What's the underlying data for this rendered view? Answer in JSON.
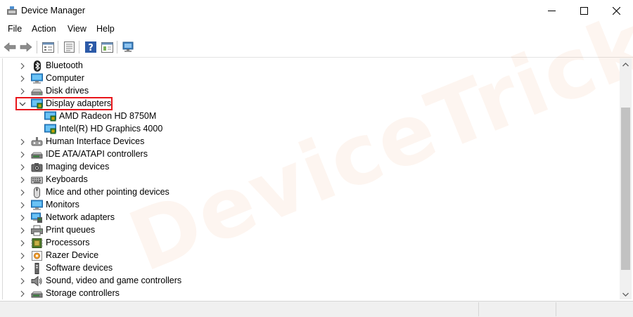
{
  "window": {
    "title": "Device Manager"
  },
  "menu": {
    "items": [
      "File",
      "Action",
      "View",
      "Help"
    ]
  },
  "toolbar": {
    "buttons": [
      "back-icon",
      "forward-icon",
      "tree-view-icon",
      "properties-icon",
      "help-icon",
      "view-icon",
      "scan-computer-icon"
    ]
  },
  "watermark": {
    "text": "DeviceTricks"
  },
  "tree": {
    "items": [
      {
        "label": "Bluetooth",
        "icon": "bluetooth-icon",
        "expanded": false,
        "level": 0
      },
      {
        "label": "Computer",
        "icon": "computer-icon",
        "expanded": false,
        "level": 0
      },
      {
        "label": "Disk drives",
        "icon": "disk-drive-icon",
        "expanded": false,
        "level": 0
      },
      {
        "label": "Display adapters",
        "icon": "display-adapter-icon",
        "expanded": true,
        "level": 0,
        "highlighted": true
      },
      {
        "label": "AMD Radeon HD 8750M",
        "icon": "display-adapter-icon",
        "level": 1
      },
      {
        "label": "Intel(R) HD Graphics 4000",
        "icon": "display-adapter-icon",
        "level": 1
      },
      {
        "label": "Human Interface Devices",
        "icon": "hid-icon",
        "expanded": false,
        "level": 0
      },
      {
        "label": "IDE ATA/ATAPI controllers",
        "icon": "ide-controller-icon",
        "expanded": false,
        "level": 0
      },
      {
        "label": "Imaging devices",
        "icon": "camera-icon",
        "expanded": false,
        "level": 0
      },
      {
        "label": "Keyboards",
        "icon": "keyboard-icon",
        "expanded": false,
        "level": 0
      },
      {
        "label": "Mice and other pointing devices",
        "icon": "mouse-icon",
        "expanded": false,
        "level": 0
      },
      {
        "label": "Monitors",
        "icon": "monitor-icon",
        "expanded": false,
        "level": 0
      },
      {
        "label": "Network adapters",
        "icon": "network-adapter-icon",
        "expanded": false,
        "level": 0
      },
      {
        "label": "Print queues",
        "icon": "printer-icon",
        "expanded": false,
        "level": 0
      },
      {
        "label": "Processors",
        "icon": "processor-icon",
        "expanded": false,
        "level": 0
      },
      {
        "label": "Razer Device",
        "icon": "razer-device-icon",
        "expanded": false,
        "level": 0
      },
      {
        "label": "Software devices",
        "icon": "software-device-icon",
        "expanded": false,
        "level": 0
      },
      {
        "label": "Sound, video and game controllers",
        "icon": "speaker-icon",
        "expanded": false,
        "level": 0
      },
      {
        "label": "Storage controllers",
        "icon": "storage-controller-icon",
        "expanded": false,
        "level": 0
      }
    ]
  },
  "colors": {
    "highlight_border": "#e8161b",
    "selection": "#ffffff",
    "scrollbar_thumb": "#c2c2c2"
  }
}
